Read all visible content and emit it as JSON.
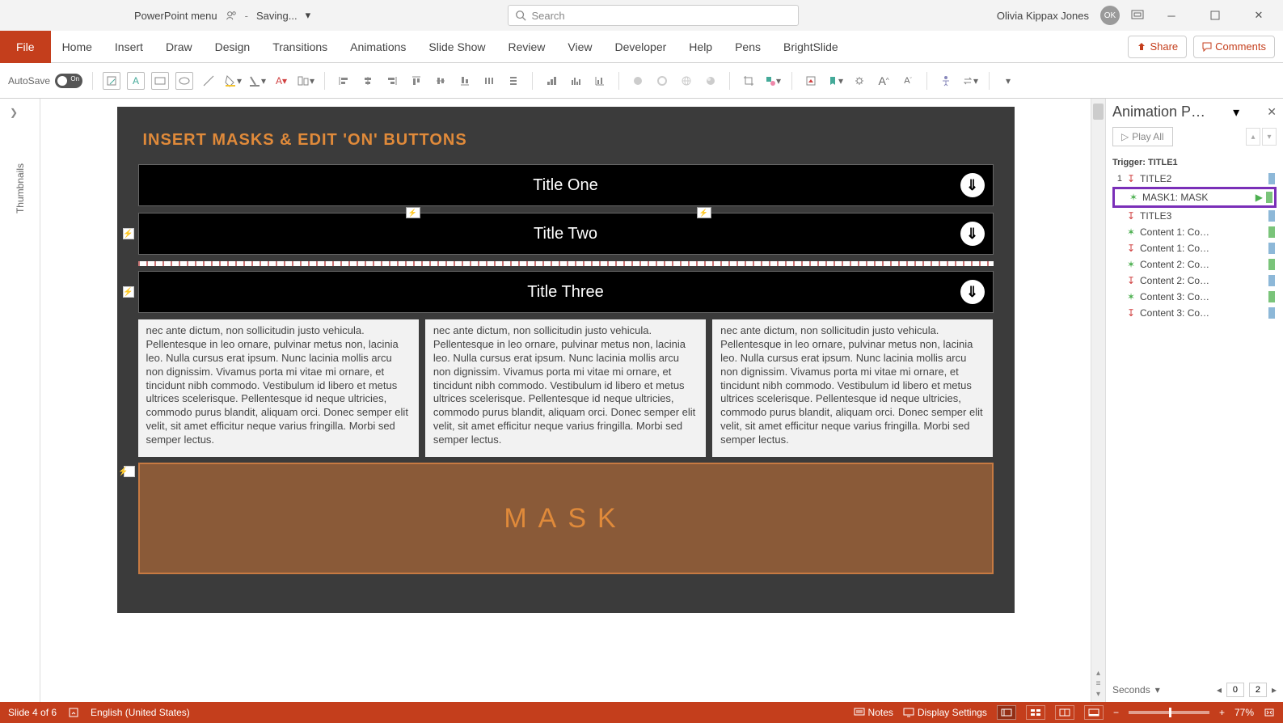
{
  "titlebar": {
    "doc_name": "PowerPoint menu",
    "saving": "Saving...",
    "search_placeholder": "Search",
    "user_name": "Olivia Kippax Jones",
    "user_initials": "OK"
  },
  "ribbon": {
    "file": "File",
    "tabs": [
      "Home",
      "Insert",
      "Draw",
      "Design",
      "Transitions",
      "Animations",
      "Slide Show",
      "Review",
      "View",
      "Developer",
      "Help",
      "Pens",
      "BrightSlide"
    ],
    "share": "Share",
    "comments": "Comments"
  },
  "toolbar": {
    "autosave_label": "AutoSave",
    "autosave_state": "On"
  },
  "thumbnails_label": "Thumbnails",
  "slide": {
    "heading": "INSERT MASKS & EDIT 'ON' BUTTONS",
    "titles": [
      "Title One",
      "Title Two",
      "Title Three"
    ],
    "body_text": "nec ante dictum, non sollicitudin justo vehicula. Pellentesque in leo ornare, pulvinar metus non, lacinia leo. Nulla cursus erat ipsum. Nunc lacinia mollis arcu non dignissim. Vivamus porta mi vitae mi ornare, et tincidunt nibh commodo. Vestibulum id libero et metus ultrices scelerisque. Pellentesque id neque ultricies, commodo purus blandit, aliquam orci. Donec semper elit velit, sit amet efficitur neque varius fringilla. Morbi sed semper lectus.",
    "mask_label": "MASK"
  },
  "anim_pane": {
    "title": "Animation P…",
    "play_all": "Play All",
    "trigger": "Trigger: TITLE1",
    "items": [
      {
        "num": "1",
        "icon": "arrow",
        "label": "TITLE2",
        "bar": "blue"
      },
      {
        "num": "",
        "icon": "star",
        "label": "MASK1: MASK",
        "bar": "green-play",
        "highlight": true
      },
      {
        "num": "",
        "icon": "arrow",
        "label": "TITLE3",
        "bar": "blue"
      },
      {
        "num": "",
        "icon": "star",
        "label": "Content 1: Co…",
        "bar": "green"
      },
      {
        "num": "",
        "icon": "arrow",
        "label": "Content 1: Co…",
        "bar": "blue"
      },
      {
        "num": "",
        "icon": "star",
        "label": "Content 2: Co…",
        "bar": "green"
      },
      {
        "num": "",
        "icon": "arrow",
        "label": "Content 2: Co…",
        "bar": "blue"
      },
      {
        "num": "",
        "icon": "star",
        "label": "Content 3: Co…",
        "bar": "green"
      },
      {
        "num": "",
        "icon": "arrow",
        "label": "Content 3: Co…",
        "bar": "blue"
      }
    ],
    "seconds": "Seconds",
    "time_a": "0",
    "time_b": "2"
  },
  "status": {
    "slide_info": "Slide 4 of 6",
    "language": "English (United States)",
    "notes": "Notes",
    "display": "Display Settings",
    "zoom": "77%"
  }
}
